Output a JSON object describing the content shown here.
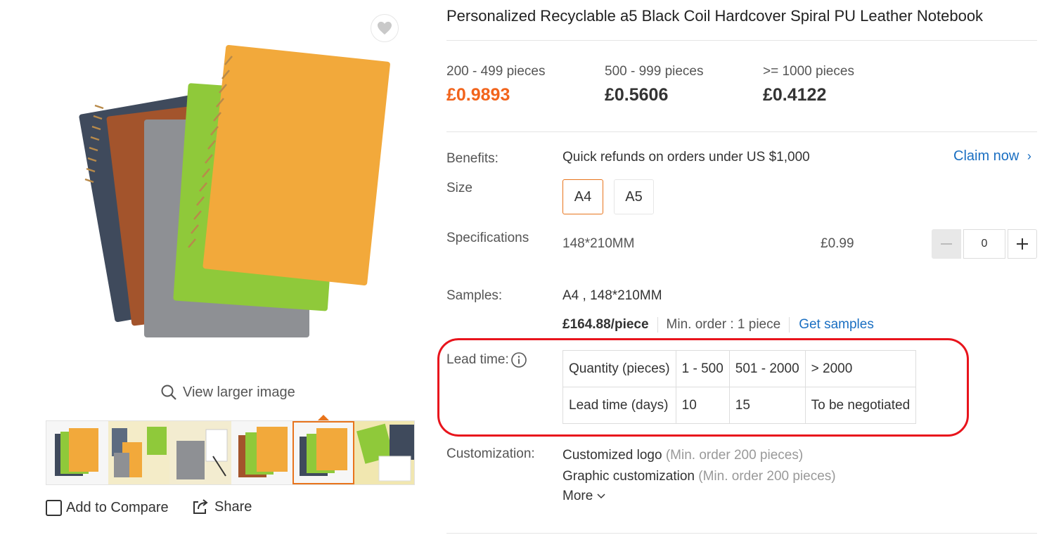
{
  "product": {
    "title": "Personalized Recyclable a5 Black Coil Hardcover Spiral PU Leather Notebook"
  },
  "gallery": {
    "view_larger_label": "View larger image",
    "thumbnail_count": 6,
    "active_thumbnail": 5,
    "add_to_compare_label": "Add to Compare",
    "share_label": "Share"
  },
  "price_tiers": [
    {
      "range": "200 - 499 pieces",
      "price": "£0.9893"
    },
    {
      "range": "500 - 999 pieces",
      "price": "£0.5606"
    },
    {
      "range": ">= 1000 pieces",
      "price": "£0.4122"
    }
  ],
  "benefits": {
    "label": "Benefits:",
    "text": "Quick refunds on orders under US $1,000",
    "claim_label": "Claim now"
  },
  "size": {
    "label": "Size",
    "options": [
      "A4",
      "A5"
    ],
    "selected": "A4"
  },
  "specifications": {
    "label": "Specifications",
    "value": "148*210MM",
    "price": "£0.99",
    "quantity": "0"
  },
  "samples": {
    "label": "Samples:",
    "value": "A4 , 148*210MM",
    "price": "£164.88/piece",
    "min_order": "Min. order : 1 piece",
    "get_samples_label": "Get samples"
  },
  "lead_time": {
    "label": "Lead time:",
    "rows": [
      [
        "Quantity (pieces)",
        "1 - 500",
        "501 - 2000",
        "> 2000"
      ],
      [
        "Lead time (days)",
        "10",
        "15",
        "To be negotiated"
      ]
    ]
  },
  "customization": {
    "label": "Customization:",
    "items": [
      {
        "name": "Customized logo",
        "min": "(Min. order 200 pieces)"
      },
      {
        "name": "Graphic customization",
        "min": "(Min. order 200 pieces)"
      }
    ],
    "more_label": "More"
  },
  "colors": {
    "accent_orange": "#e8741c",
    "price_orange": "#f2641c",
    "link_blue": "#1a6fc2",
    "highlight_red": "#e8141c"
  }
}
